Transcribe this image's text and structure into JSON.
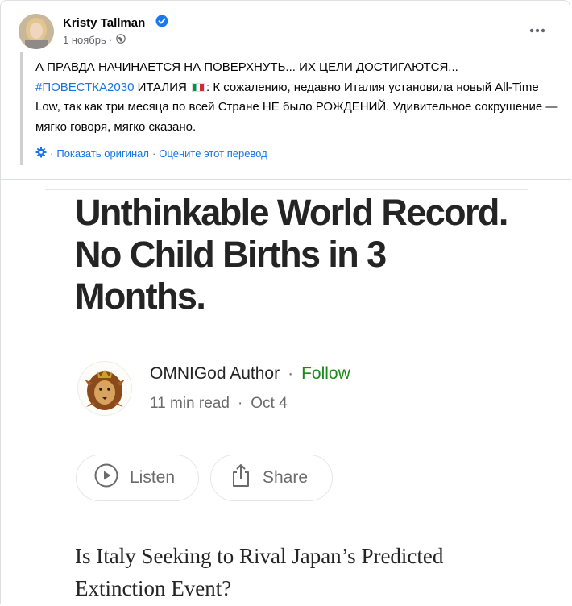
{
  "post": {
    "author": "Kristy Tallman",
    "date": "1 ноябрь",
    "date_sep": "·",
    "icons": [
      "verified-badge-icon",
      "globe-icon",
      "more-icon",
      "translate-gear-icon"
    ],
    "text_part1": "А ПРАВДА НАЧИНАЕТСЯ НА ПОВЕРХНУТЬ... ИХ ЦЕЛИ ДОСТИГАЮТСЯ...",
    "hashtag": "#ПОВЕСТКА2030",
    "text_part2": " ИТАЛИЯ ",
    "text_part3": ": К сожалению, недавно Италия установила новый All-Time Low, так как три месяца по всей Стране НЕ было РОЖДЕНИЙ. Удивительное сокрушение — мягко говоря, мягко сказано.",
    "translate_sep1": "·",
    "show_original": "Показать оригинал",
    "translate_sep2": "·",
    "rate_translation": "Оцените этот перевод"
  },
  "article": {
    "title": "Unthinkable World Record. No Child Births in 3 Months.",
    "author": "OMNIGod Author",
    "author_sep": "·",
    "follow": "Follow",
    "read_time": "11 min read",
    "read_sep": "·",
    "date": "Oct 4",
    "listen_label": "Listen",
    "share_label": "Share",
    "subtitle": "Is Italy Seeking to Rival Japan’s Predicted Extinction Event?",
    "icons": [
      "play-icon",
      "share-icon",
      "lion-avatar"
    ]
  },
  "colors": {
    "link_blue": "#1b74e4",
    "follow_green": "#1a8917",
    "meta_gray": "#65676b"
  }
}
